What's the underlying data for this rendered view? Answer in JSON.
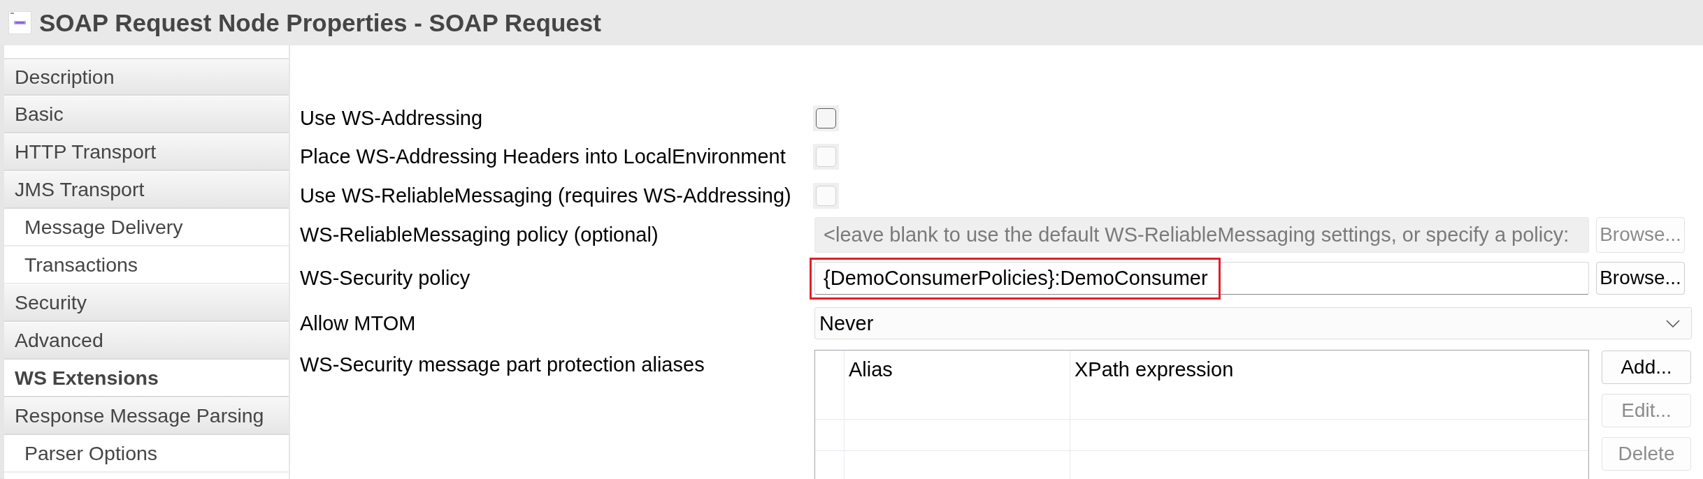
{
  "window": {
    "title": "SOAP Request Node Properties - SOAP Request"
  },
  "sidebar": {
    "items": [
      {
        "label": "Description",
        "selected": false
      },
      {
        "label": "Basic",
        "selected": false
      },
      {
        "label": "HTTP Transport",
        "selected": false
      },
      {
        "label": "JMS Transport",
        "selected": false,
        "children": [
          {
            "label": "Message Delivery",
            "selected": false
          },
          {
            "label": "Transactions",
            "selected": false
          }
        ]
      },
      {
        "label": "Security",
        "selected": false
      },
      {
        "label": "Advanced",
        "selected": false
      },
      {
        "label": "WS Extensions",
        "selected": true
      },
      {
        "label": "Response Message Parsing",
        "selected": false,
        "children": [
          {
            "label": "Parser Options",
            "selected": false
          }
        ]
      }
    ]
  },
  "form": {
    "fields": [
      {
        "kind": "checkbox",
        "label": "Use WS-Addressing",
        "checked": false,
        "disabled": false
      },
      {
        "kind": "checkbox",
        "label": "Place WS-Addressing Headers into LocalEnvironment",
        "checked": false,
        "disabled": true
      },
      {
        "kind": "checkbox",
        "label": "Use WS-ReliableMessaging (requires WS-Addressing)",
        "checked": false,
        "disabled": true
      },
      {
        "kind": "text",
        "label": "WS-ReliableMessaging policy (optional)",
        "placeholder": "<leave blank to use the default WS-ReliableMessaging settings, or specify a policy:",
        "disabled": true,
        "button": {
          "label": "Browse...",
          "disabled": true
        }
      },
      {
        "kind": "text",
        "label": "WS-Security policy",
        "value": "{DemoConsumerPolicies}:DemoConsumer",
        "disabled": false,
        "highlighted": true,
        "button": {
          "label": "Browse...",
          "disabled": false
        }
      },
      {
        "kind": "dropdown",
        "label": "Allow MTOM",
        "value": "Never"
      },
      {
        "kind": "table",
        "label": "WS-Security message part protection aliases",
        "columns": [
          "Alias",
          "XPath expression"
        ],
        "buttons": [
          {
            "label": "Add...",
            "disabled": false
          },
          {
            "label": "Edit...",
            "disabled": true
          },
          {
            "label": "Delete",
            "disabled": true
          }
        ]
      }
    ]
  }
}
